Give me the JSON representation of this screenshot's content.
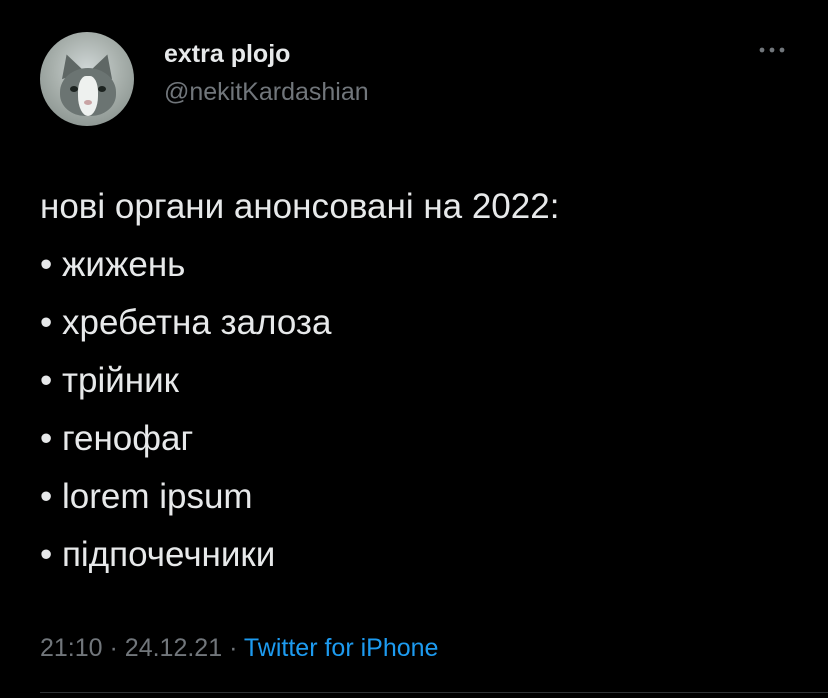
{
  "author": {
    "display_name": "extra plojo",
    "handle": "@nekitKardashian"
  },
  "header": {
    "more_icon": "more-horizontal-icon"
  },
  "tweet": {
    "lines": [
      "нові органи анонсовані на 2022:",
      "• жижень",
      "• хребетна залоза",
      "• трійник",
      "• генофаг",
      "• lorem ipsum",
      "• підпочечники"
    ]
  },
  "meta": {
    "time": "21:10",
    "separator": "·",
    "date": "24.12.21",
    "source": "Twitter for iPhone"
  },
  "colors": {
    "background": "#000000",
    "text": "#e7e9ea",
    "secondary": "#71767b",
    "link": "#1d9bf0"
  }
}
